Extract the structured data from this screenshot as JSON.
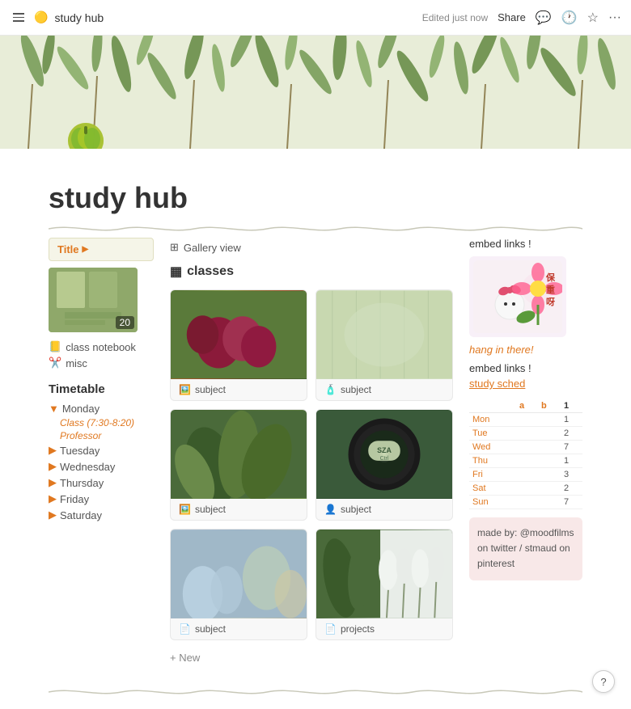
{
  "topbar": {
    "emoji": "🟡",
    "title": "study hub",
    "edit_status": "Edited just now",
    "share_label": "Share"
  },
  "page": {
    "title": "study hub",
    "icon": "🍐"
  },
  "left_sidebar": {
    "title_box": "Title",
    "badge_number": "20",
    "links": [
      {
        "icon": "📒",
        "label": "class notebook"
      },
      {
        "icon": "✂️",
        "label": "misc"
      }
    ],
    "timetable_title": "Timetable",
    "days": [
      {
        "label": "Monday",
        "expanded": true,
        "sub": [
          "Class (7:30-8:20)",
          "Professor"
        ]
      },
      {
        "label": "Tuesday"
      },
      {
        "label": "Wednesday"
      },
      {
        "label": "Thursday"
      },
      {
        "label": "Friday"
      },
      {
        "label": "Saturday"
      }
    ]
  },
  "gallery": {
    "view_label": "Gallery view",
    "classes_label": "classes",
    "cards": [
      {
        "type": "figs",
        "footer_icon": "🖼️",
        "footer_label": "subject"
      },
      {
        "type": "green-fabric",
        "footer_icon": "🧴",
        "footer_label": "subject"
      },
      {
        "type": "green-plants",
        "footer_icon": "🖼️",
        "footer_label": "subject"
      },
      {
        "type": "vinyl",
        "footer_icon": "👤",
        "footer_label": "subject"
      },
      {
        "type": "blue-flowers",
        "footer_icon": "📄",
        "footer_label": "subject"
      },
      {
        "type": "white-tulips",
        "footer_icon": "📄",
        "footer_label": "projects"
      }
    ],
    "add_new_label": "+ New"
  },
  "right_sidebar": {
    "embed_title": "embed links !",
    "sticker_chinese": "保重呀",
    "hang_there": "hang in there!",
    "embed_links2": "embed links !",
    "study_sched_link": "study sched",
    "schedule": {
      "headers": [
        "a",
        "b",
        "1"
      ],
      "rows": [
        {
          "day": "Mon",
          "a": "",
          "b": "",
          "c": "1"
        },
        {
          "day": "Tue",
          "a": "",
          "b": "",
          "c": "2"
        },
        {
          "day": "Wed",
          "a": "",
          "b": "",
          "c": "7"
        },
        {
          "day": "Thu",
          "a": "",
          "b": "",
          "c": "1"
        },
        {
          "day": "Fri",
          "a": "",
          "b": "",
          "c": "3"
        },
        {
          "day": "Sat",
          "a": "",
          "b": "",
          "c": "2"
        },
        {
          "day": "Sun",
          "a": "",
          "b": "",
          "c": "7"
        }
      ]
    },
    "made_by": "made by: @moodfilms on twitter / stmaud on pinterest"
  }
}
